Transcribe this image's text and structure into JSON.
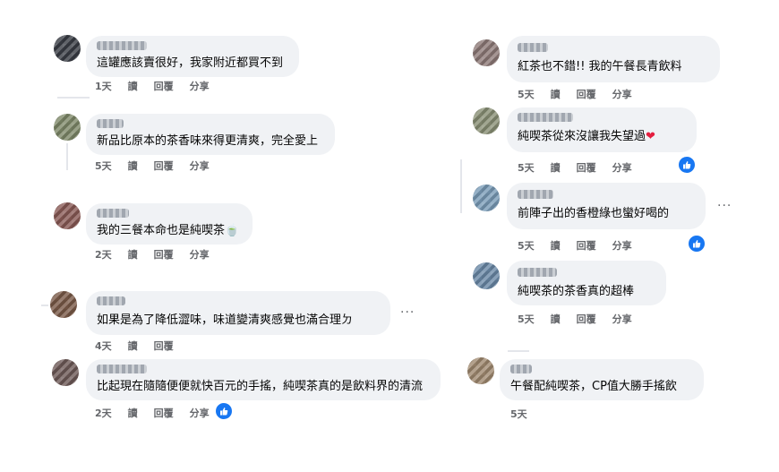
{
  "actions": {
    "read": "讀",
    "reply": "回覆",
    "share": "分享"
  },
  "colors": {
    "bubble": "#f0f2f5",
    "action_text": "#65676b",
    "like_blue": "#1877f2",
    "heart": "#e41e3f"
  },
  "comments": [
    {
      "text": "這罐應該賣很好，我家附近都買不到",
      "time": "1天",
      "avatar_color": "#3a3d45"
    },
    {
      "text": "新品比原本的茶香味來得更清爽，完全愛上",
      "time": "5天",
      "avatar_color": "#7f8a6a"
    },
    {
      "text": "我的三餐本命也是純喫茶",
      "emoji": "🍵",
      "time": "2天",
      "avatar_color": "#8a5a56"
    },
    {
      "text": "如果是為了降低澀味，味道變清爽感覺也滿合理ㄉ",
      "time": "4天",
      "avatar_color": "#7a5a48"
    },
    {
      "text": "比起現在隨隨便便就快百元的手搖，純喫茶真的是飲料界的清流",
      "time": "2天",
      "avatar_color": "#6e5a58"
    },
    {
      "text": "紅茶也不錯!! 我的午餐長青飲料",
      "time": "5天",
      "avatar_color": "#8e7a78"
    },
    {
      "text": "純喫茶從來沒讓我失望過",
      "emoji": "❤",
      "time": "5天",
      "avatar_color": "#8a9076"
    },
    {
      "text": "前陣子出的香橙綠也蠻好喝的",
      "time": "5天",
      "avatar_color": "#7a9cb8"
    },
    {
      "text": "純喫茶的茶香真的超棒",
      "time": "5天",
      "avatar_color": "#6b8aa8"
    },
    {
      "text": "午餐配純喫茶，CP值大勝手搖飲",
      "time": "5天",
      "avatar_color": "#a08a70"
    }
  ],
  "icons": {
    "more": "more-options-icon",
    "like": "like-thumb-icon"
  },
  "more_glyph": "···"
}
